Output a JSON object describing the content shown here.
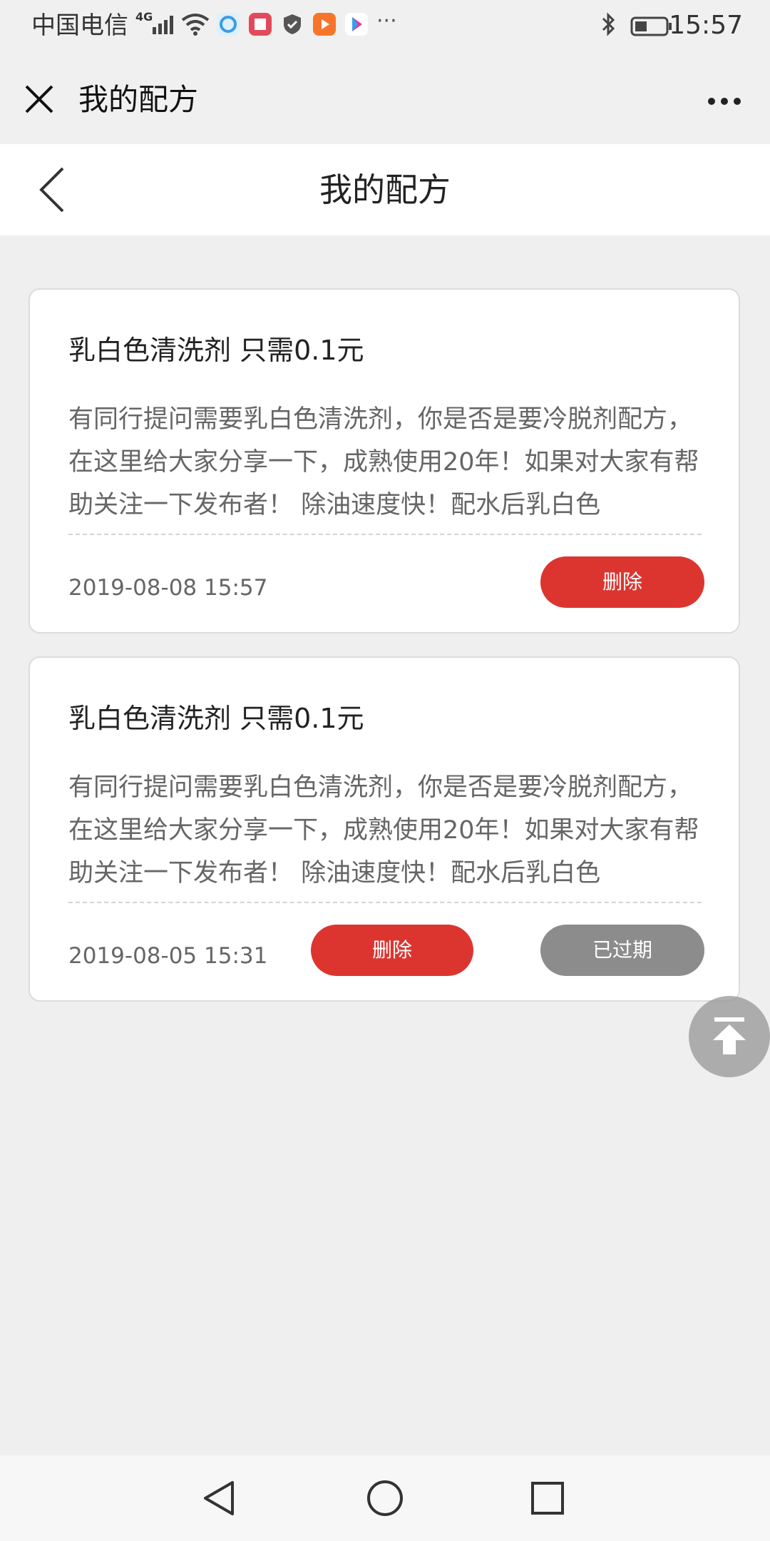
{
  "status_bar": {
    "carrier": "中国电信",
    "network": "4G",
    "time": "15:57",
    "icons": [
      "signal-icon",
      "wifi-icon",
      "browser-app-icon",
      "reader-app-icon",
      "shield-app-icon",
      "video-app-icon",
      "youku-app-icon",
      "more-notifications-icon",
      "bluetooth-icon",
      "battery-icon"
    ]
  },
  "title_bar": {
    "title": "我的配方",
    "close_icon": "close-icon",
    "more_icon": "more-icon"
  },
  "header": {
    "title": "我的配方",
    "back_icon": "back-icon"
  },
  "recipes": [
    {
      "title": "乳白色清洗剂 只需0.1元",
      "description": "有同行提问需要乳白色清洗剂，你是否是要冷脱剂配方，在这里给大家分享一下，成熟使用20年！如果对大家有帮助关注一下发布者！ 除油速度快！配水后乳白色",
      "date": "2019-08-08 15:57",
      "delete_label": "删除"
    },
    {
      "title": "乳白色清洗剂 只需0.1元",
      "description": "有同行提问需要乳白色清洗剂，你是否是要冷脱剂配方，在这里给大家分享一下，成熟使用20年！如果对大家有帮助关注一下发布者！ 除油速度快！配水后乳白色",
      "date": "2019-08-05 15:31",
      "delete_label": "删除",
      "status_label": "已过期"
    }
  ],
  "floating": {
    "icon": "back-to-top-icon"
  },
  "nav_bar": {
    "icons": [
      "nav-back-icon",
      "nav-home-icon",
      "nav-recent-icon"
    ]
  },
  "colors": {
    "accent_red": "#dc3530",
    "expired_gray": "#8c8c8c",
    "background": "#efeff0"
  }
}
